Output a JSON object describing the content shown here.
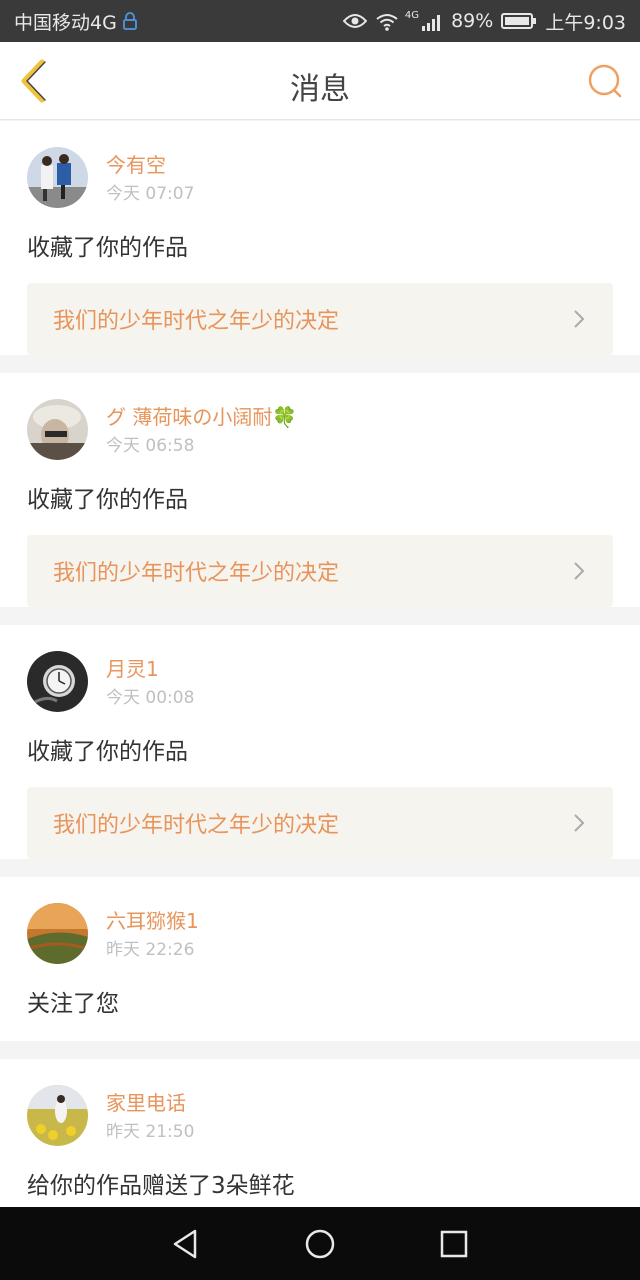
{
  "status_bar": {
    "carrier": "中国移动4G",
    "network_small": "4G",
    "battery": "89%",
    "time": "上午9:03"
  },
  "header": {
    "title": "消息"
  },
  "colors": {
    "accent": "#e8945a",
    "work_box_bg": "#f5f4ee",
    "status_bar_bg": "#3a3a3a",
    "nav_bar_bg": "#0b0b0b"
  },
  "messages": [
    {
      "username": "今有空",
      "time": "今天 07:07",
      "action": "收藏了你的作品",
      "work_title": "我们的少年时代之年少的决定"
    },
    {
      "username": "グ 薄荷味の小阔耐🍀",
      "time": "今天 06:58",
      "action": "收藏了你的作品",
      "work_title": "我们的少年时代之年少的决定"
    },
    {
      "username": "月灵1",
      "time": "今天 00:08",
      "action": "收藏了你的作品",
      "work_title": "我们的少年时代之年少的决定"
    },
    {
      "username": "六耳猕猴1",
      "time": "昨天 22:26",
      "action": "关注了您"
    },
    {
      "username": "家里电话",
      "time": "昨天 21:50",
      "action": "给你的作品赠送了3朵鲜花"
    }
  ],
  "icons": {
    "back": "chevron-left-icon",
    "search": "search-icon",
    "nav_back": "triangle-back-icon",
    "nav_home": "circle-home-icon",
    "nav_recents": "square-recents-icon"
  }
}
